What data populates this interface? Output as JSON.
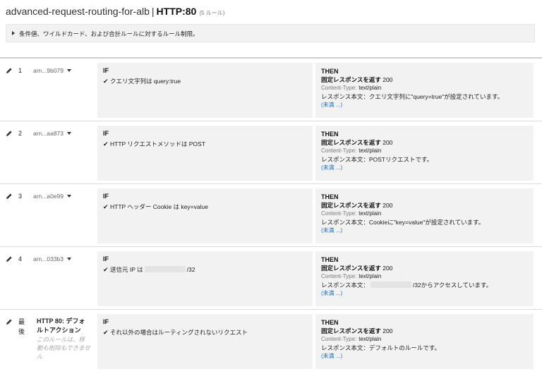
{
  "header": {
    "lb_name": "advanced-request-routing-for-alb",
    "separator": "|",
    "listener": "HTTP:80",
    "rule_count": "(5 ルール)"
  },
  "limits": {
    "label": "条件値、ワイルドカード、および合計ルールに対するルール制限。"
  },
  "labels": {
    "if": "IF",
    "then": "THEN",
    "content_type_label": "Content-Type:",
    "more": "(未満 ...)"
  },
  "rules": [
    {
      "priority": "1",
      "arn": "arn...9b079",
      "condition": "クエリ文字列は query:true",
      "action": "固定レスポンスを返す",
      "status_code": "200",
      "content_type": "text/plain",
      "body": "レスポンス本文：クエリ文字列に\"query=true\"が設定されています。"
    },
    {
      "priority": "2",
      "arn": "arn...aa873",
      "condition": "HTTP リクエストメソッドは POST",
      "action": "固定レスポンスを返す",
      "status_code": "200",
      "content_type": "text/plain",
      "body": "レスポンス本文：POSTリクエストです。"
    },
    {
      "priority": "3",
      "arn": "arn...a0e99",
      "condition": "HTTP ヘッダー Cookie は key=value",
      "action": "固定レスポンスを返す",
      "status_code": "200",
      "content_type": "text/plain",
      "body": "レスポンス本文：Cookieに\"key=value\"が設定されています。"
    },
    {
      "priority": "4",
      "arn": "arn...033b3",
      "condition_prefix": "送信元 IP は",
      "condition_suffix": "/32",
      "action": "固定レスポンスを返す",
      "status_code": "200",
      "content_type": "text/plain",
      "body_prefix": "レスポンス本文：",
      "body_suffix": "/32からアクセスしています。"
    },
    {
      "priority": "最後",
      "name": "HTTP 80: デフォルトアクション",
      "note": "このルールは、移動も削除もできません",
      "condition": "それ以外の場合はルーティングされないリクエスト",
      "action": "固定レスポンスを返す",
      "status_code": "200",
      "content_type": "text/plain",
      "body": "レスポンス本文：デフォルトのルールです。"
    }
  ]
}
